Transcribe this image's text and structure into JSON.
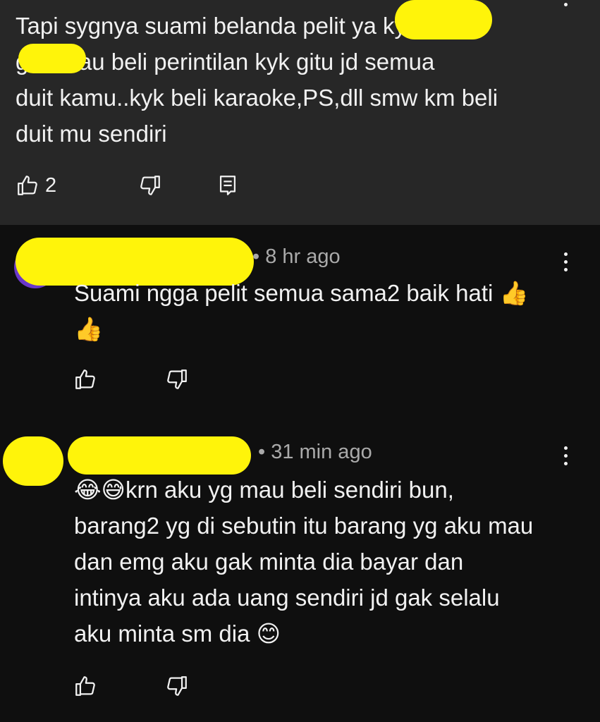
{
  "comments": [
    {
      "text": "Tapi sygnya suami belanda pelit ya      kyk\n          gak mau beli perintilan kyk gitu jd semua\nduit kamu..kyk beli karaoke,PS,dll smw km beli\nduit mu sendiri",
      "likes": "2"
    },
    {
      "meta": "• 8 hr ago",
      "text": "Suami ngga pelit semua sama2 baik hati 👍\n👍"
    },
    {
      "meta": "• 31 min ago",
      "text": "😂😅krn aku yg mau beli sendiri bun,\nbarang2 yg di sebutin itu barang yg aku mau\ndan emg aku gak minta dia bayar dan\nintinya aku ada uang sendiri jd gak selalu\naku minta sm dia 😊"
    }
  ],
  "icons": {
    "like": "thumbs-up-icon",
    "dislike": "thumbs-down-icon",
    "reply": "reply-icon",
    "more": "more-vertical-icon"
  },
  "colors": {
    "highlight_bg": "#272727",
    "bg": "#0f0f0f",
    "text": "#f1f1f1",
    "meta": "#aaaaaa",
    "redaction": "#fff40a"
  }
}
